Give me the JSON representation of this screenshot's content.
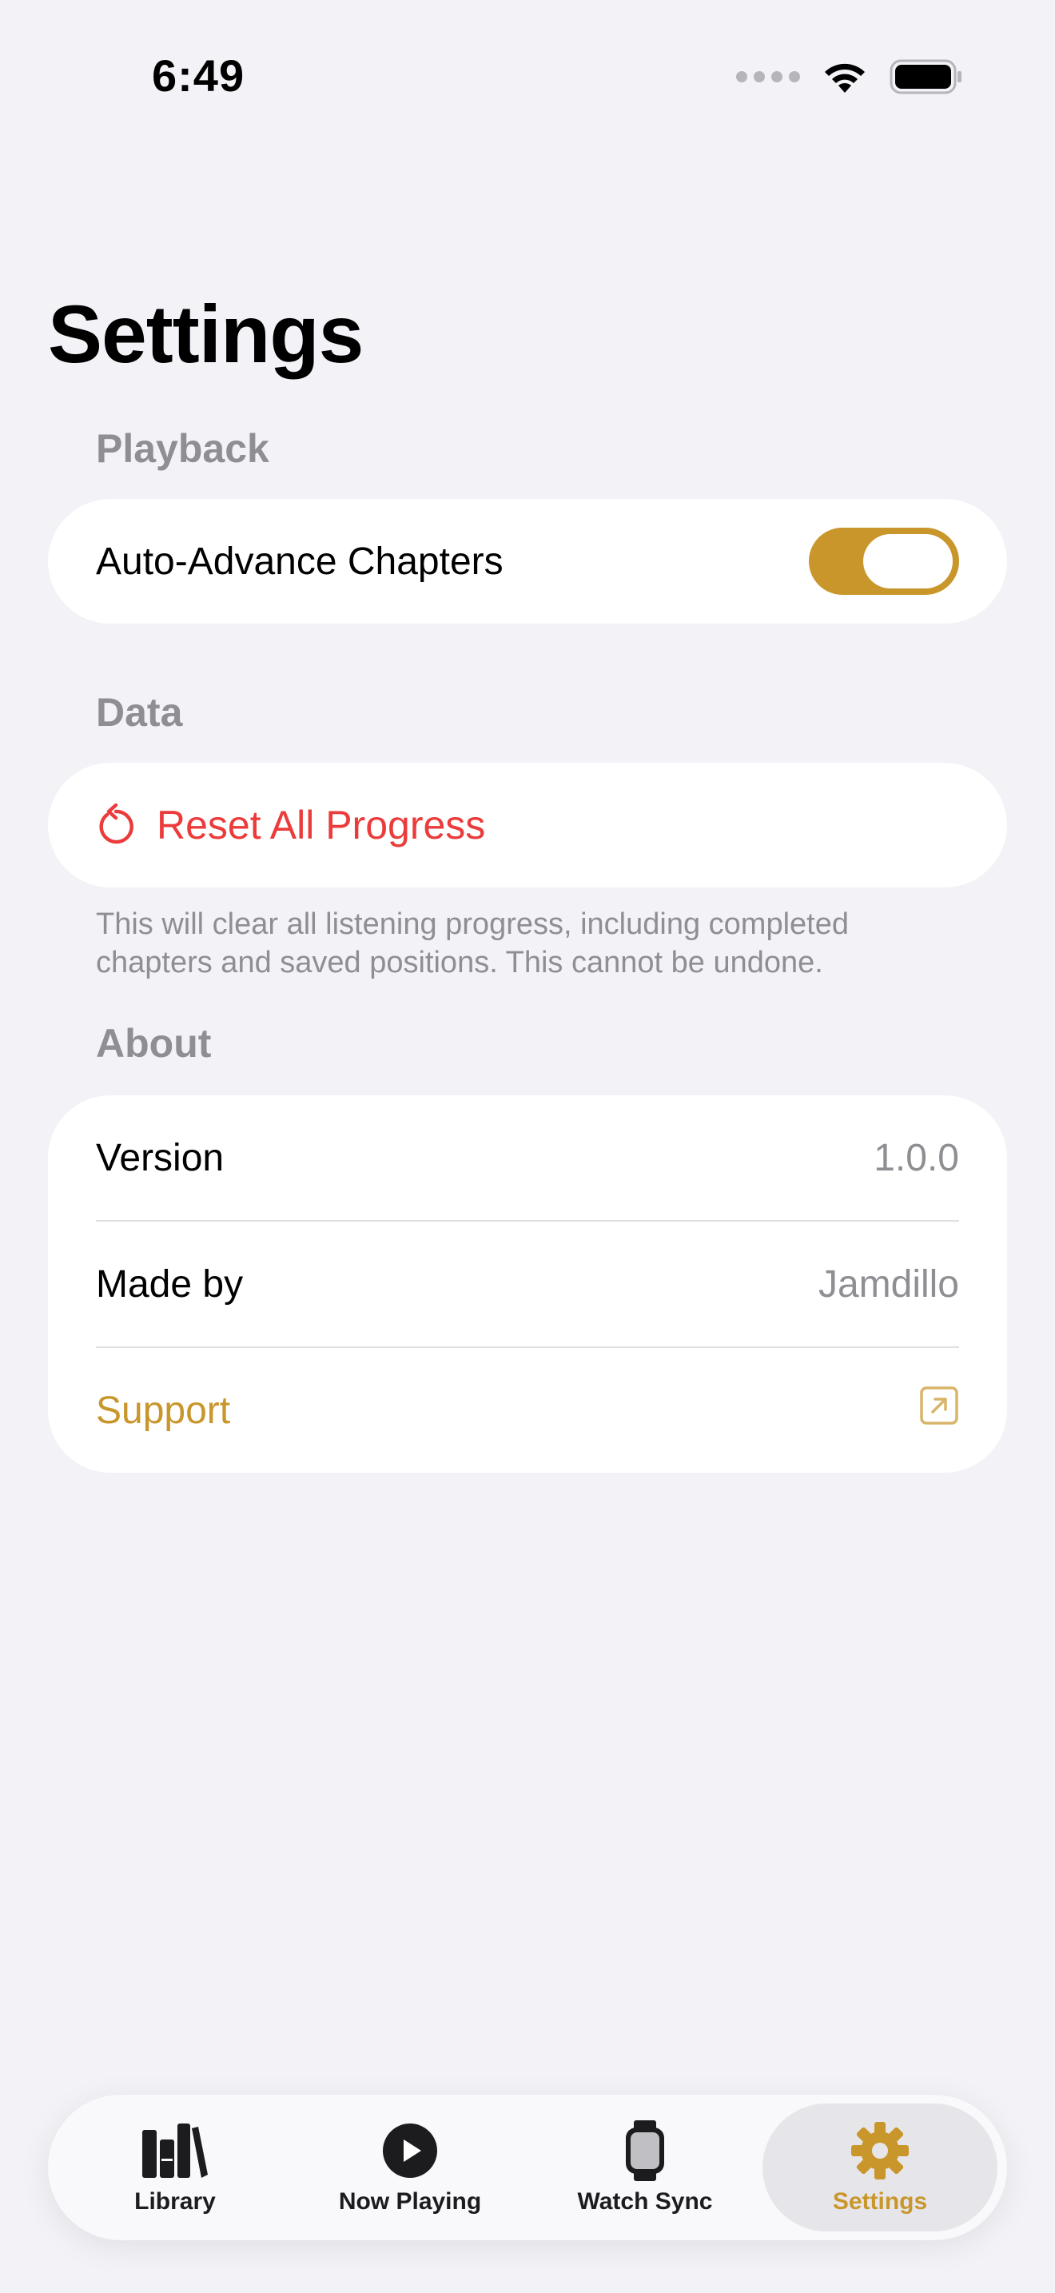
{
  "status_bar": {
    "time": "6:49"
  },
  "page_title": "Settings",
  "sections": {
    "playback": {
      "header": "Playback",
      "auto_advance_label": "Auto-Advance Chapters",
      "auto_advance_enabled": true
    },
    "data": {
      "header": "Data",
      "reset_label": "Reset All Progress",
      "footnote": "This will clear all listening progress, including completed chapters and saved positions. This cannot be undone."
    },
    "about": {
      "header": "About",
      "version_label": "Version",
      "version_value": "1.0.0",
      "made_by_label": "Made by",
      "made_by_value": "Jamdillo",
      "support_label": "Support"
    }
  },
  "tab_bar": {
    "tabs": [
      {
        "label": "Library",
        "icon": "books-icon",
        "active": false
      },
      {
        "label": "Now Playing",
        "icon": "play-circle-icon",
        "active": false
      },
      {
        "label": "Watch Sync",
        "icon": "watch-icon",
        "active": false
      },
      {
        "label": "Settings",
        "icon": "gear-icon",
        "active": true
      }
    ]
  },
  "colors": {
    "accent": "#c9962b",
    "destructive": "#eb3b3b",
    "background": "#f2f2f7",
    "secondary_text": "#8e8e93"
  }
}
